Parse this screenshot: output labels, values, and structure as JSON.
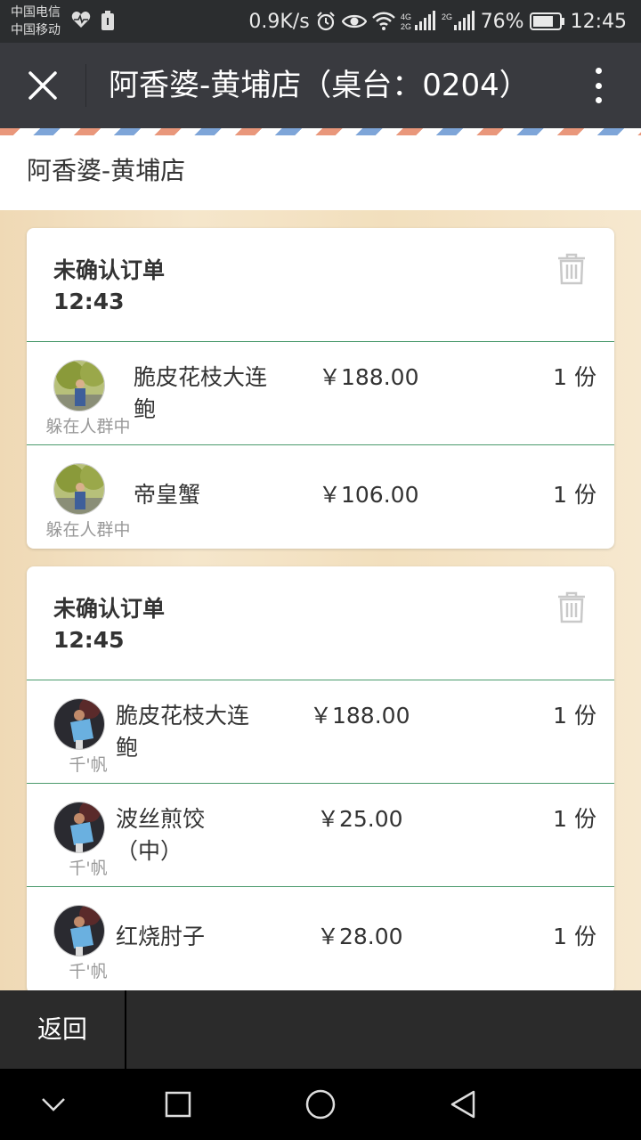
{
  "status_bar": {
    "carrier_1": "中国电信",
    "carrier_2": "中国移动",
    "net_speed": "0.9K/s",
    "battery": "76%",
    "time": "12:45"
  },
  "title_bar": {
    "title": "阿香婆-黄埔店（桌台：0204）"
  },
  "shop": {
    "name": "阿香婆-黄埔店"
  },
  "orders": [
    {
      "status": "未确认订单",
      "time": "12:43",
      "items": [
        {
          "user": "躲在人群中",
          "dish": "脆皮花枝大连鲍",
          "price": "￥188.00",
          "qty": "1 份"
        },
        {
          "user": "躲在人群中",
          "dish": "帝皇蟹",
          "price": "￥106.00",
          "qty": "1 份"
        }
      ]
    },
    {
      "status": "未确认订单",
      "time": "12:45",
      "items": [
        {
          "user": "千'帆",
          "dish": "脆皮花枝大连鲍",
          "price": "￥188.00",
          "qty": "1 份"
        },
        {
          "user": "千'帆",
          "dish": "波丝煎饺（中）",
          "price": "￥25.00",
          "qty": "1 份"
        },
        {
          "user": "千'帆",
          "dish": "红烧肘子",
          "price": "￥28.00",
          "qty": "1 份"
        }
      ]
    }
  ],
  "bottom_bar": {
    "back_label": "返回"
  },
  "icons": {
    "close": "close-icon",
    "more": "more-vertical-icon",
    "trash": "trash-icon",
    "nav_back": "chevron-down-icon",
    "nav_recent": "square-icon",
    "nav_home": "circle-icon",
    "nav_triangle": "triangle-back-icon"
  },
  "colors": {
    "title_bar": "#393a3f",
    "divider_green": "#4a9a6c",
    "wood_background": "#f2dfbd"
  }
}
